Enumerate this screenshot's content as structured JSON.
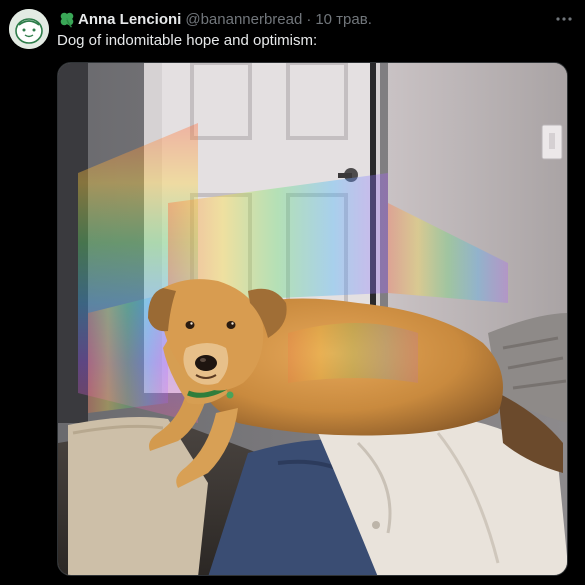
{
  "author": {
    "emoji_icon": "four-leaf-clover-icon",
    "name": "Anna Lencioni",
    "handle": "@banannerbread",
    "separator": "·",
    "timestamp": "10 трав."
  },
  "tweet": {
    "text": "Dog of indomitable hope and optimism:"
  },
  "media": {
    "subject": "dog-photo"
  },
  "colors": {
    "background": "#000000",
    "text_primary": "#e7e9ea",
    "text_secondary": "#71767b",
    "clover": "#3aa757"
  }
}
